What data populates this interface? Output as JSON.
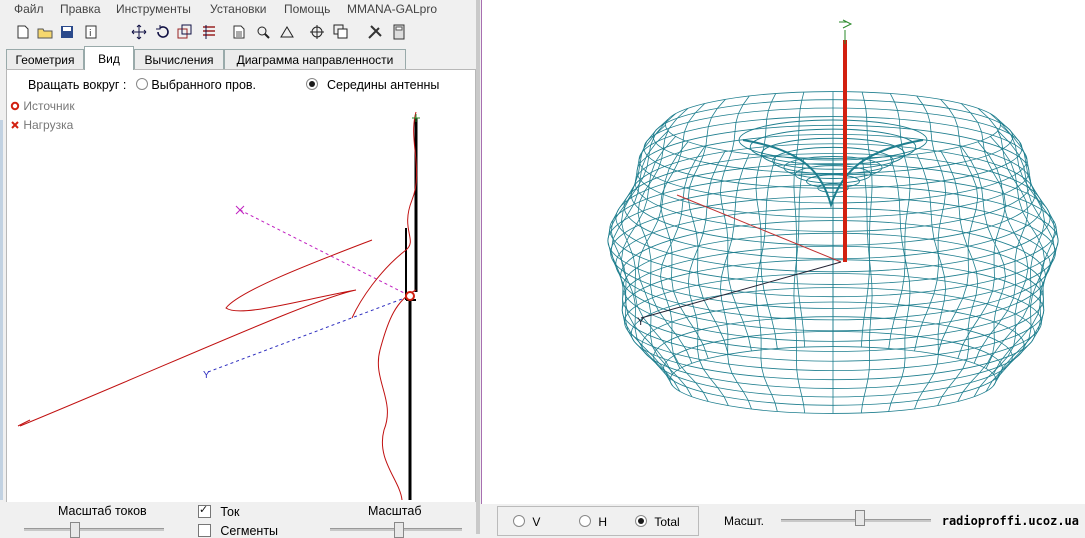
{
  "menu": {
    "items": [
      "Файл",
      "Правка",
      "Инструменты",
      "Установки",
      "Помощь",
      "MMANA-GALpro"
    ]
  },
  "toolbar": {
    "icons": [
      "new-file-icon",
      "open-folder-icon",
      "save-icon",
      "info-icon",
      "move-icon",
      "rotate-icon",
      "copy-icon",
      "list-icon",
      "document-icon",
      "zoom-icon",
      "triangle-icon",
      "target-icon",
      "clone-icon",
      "tools-icon",
      "calculator-icon"
    ]
  },
  "tabs": [
    {
      "label": "Геометрия",
      "active": false
    },
    {
      "label": "Вид",
      "active": true
    },
    {
      "label": "Вычисления",
      "active": false
    },
    {
      "label": "Диаграмма направленности",
      "active": false
    }
  ],
  "view": {
    "rotate_label": "Вращать вокруг :",
    "option_selected_wire": "Выбранного пров.",
    "option_center": "Середины антенны",
    "selected_option": "center",
    "legend_source": "Источник",
    "legend_load": "Нагрузка",
    "axis_y1": "Y",
    "axis_y2": "Y"
  },
  "bottom_left": {
    "current_scale_label": "Масштаб токов",
    "current_checkbox": "Ток",
    "current_checked": true,
    "segments_checkbox": "Сегменты",
    "segments_checked": false,
    "scale_label": "Масштаб"
  },
  "pattern": {
    "mode_v": "V",
    "mode_h": "H",
    "mode_total": "Total",
    "selected_mode": "Total",
    "scale_label": "Масшт.",
    "axis_y": "Y",
    "mesh_color": "#1e7e8e",
    "mast_color": "#d22010"
  },
  "watermark": "radioproffi.ucoz.ua",
  "colors": {
    "accent_red": "#d22010",
    "pattern_teal": "#1e7e8e",
    "axis_purple": "#c020c0",
    "axis_blue": "#3030c0"
  }
}
